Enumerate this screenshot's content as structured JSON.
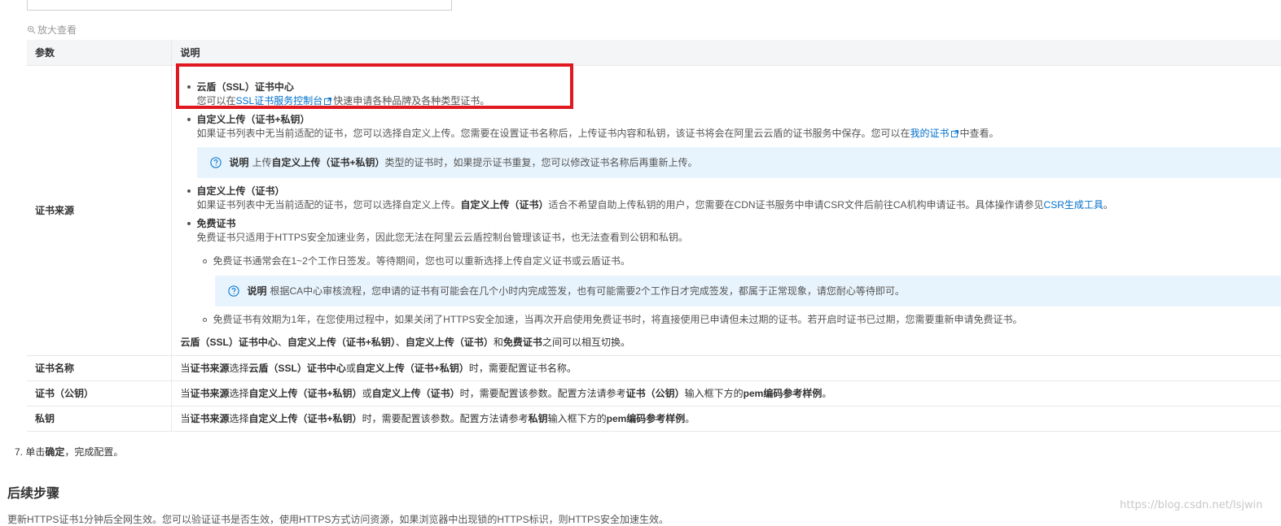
{
  "zoom_label": "放大查看",
  "table": {
    "header_param": "参数",
    "header_desc": "说明",
    "rows": {
      "source": {
        "name": "证书来源",
        "cloud_shield_title": "云盾（SSL）证书中心",
        "cloud_shield_text_prefix": "您可以在",
        "cloud_shield_link": "SSL证书服务控制台",
        "cloud_shield_text_suffix": "快速申请各种品牌及各种类型证书。",
        "custom_key_title": "自定义上传（证书+私钥）",
        "custom_key_text_prefix": "如果证书列表中无当前适配的证书，您可以选择自定义上传。您需要在设置证书名称后，上传证书内容和私钥，该证书将会在阿里云云盾的证书服务中保存。您可以在",
        "custom_key_link": "我的证书",
        "custom_key_text_suffix": "中查看。",
        "note1_label": "说明",
        "note1_prefix": "上传",
        "note1_bold": "自定义上传（证书+私钥）",
        "note1_suffix": "类型的证书时，如果提示证书重复，您可以修改证书名称后再重新上传。",
        "custom_cert_title": "自定义上传（证书）",
        "custom_cert_text_prefix": "如果证书列表中无当前适配的证书，您可以选择自定义上传。",
        "custom_cert_bold": "自定义上传（证书）",
        "custom_cert_text_mid": "适合不希望自助上传私钥的用户，您需要在CDN证书服务中申请CSR文件后前往CA机构申请证书。具体操作请参见",
        "custom_cert_link": "CSR生成工具",
        "custom_cert_text_end": "。",
        "free_title": "免费证书",
        "free_text": "免费证书只适用于HTTPS安全加速业务，因此您无法在阿里云云盾控制台管理该证书，也无法查看到公钥和私钥。",
        "free_sub1": "免费证书通常会在1~2个工作日签发。等待期间，您也可以重新选择上传自定义证书或云盾证书。",
        "note2_label": "说明",
        "note2_text": "根据CA中心审核流程，您申请的证书有可能会在几个小时内完成签发，也有可能需要2个工作日才完成签发，都属于正常现象，请您耐心等待即可。",
        "free_sub2": "免费证书有效期为1年，在您使用过程中，如果关闭了HTTPS安全加速，当再次开启使用免费证书时，将直接使用已申请但未过期的证书。若开启时证书已过期，您需要重新申请免费证书。",
        "switch_b1": "云盾（SSL）证书中心",
        "switch_sep1": "、",
        "switch_b2": "自定义上传（证书+私钥）",
        "switch_sep2": "、",
        "switch_b3": "自定义上传（证书）",
        "switch_and": "和",
        "switch_b4": "免费证书",
        "switch_end": "之间可以相互切换。"
      },
      "name": {
        "name": "证书名称",
        "t1": "当",
        "b1": "证书来源",
        "t2": "选择",
        "b2": "云盾（SSL）证书中心",
        "t3": "或",
        "b3": "自定义上传（证书+私钥）",
        "t4": "时，需要配置证书名称。"
      },
      "pubkey": {
        "name": "证书（公钥）",
        "t1": "当",
        "b1": "证书来源",
        "t2": "选择",
        "b2": "自定义上传（证书+私钥）",
        "t3": "或",
        "b3": "自定义上传（证书）",
        "t4": "时，需要配置该参数。配置方法请参考",
        "b4": "证书（公钥）",
        "t5": "输入框下方的",
        "b5": "pem编码参考样例",
        "t6": "。"
      },
      "privkey": {
        "name": "私钥",
        "t1": "当",
        "b1": "证书来源",
        "t2": "选择",
        "b2": "自定义上传（证书+私钥）",
        "t3": "时，需要配置该参数。配置方法请参考",
        "b3": "私钥",
        "t4": "输入框下方的",
        "b4": "pem编码参考样例",
        "t5": "。"
      }
    }
  },
  "step": {
    "number": "7.",
    "prefix": "单击",
    "bold": "确定",
    "suffix": "，完成配置。"
  },
  "section_title": "后续步骤",
  "bottom_text": "更新HTTPS证书1分钟后全网生效。您可以验证证书是否生效，使用HTTPS方式访问资源，如果浏览器中出现锁的HTTPS标识，则HTTPS安全加速生效。",
  "watermark": "https://blog.csdn.net/lsjwin",
  "colors": {
    "link": "#0070cc",
    "highlight_box": "#e0181f",
    "note_bg": "#e8f4fd",
    "header_bg": "#f4f5f7"
  }
}
